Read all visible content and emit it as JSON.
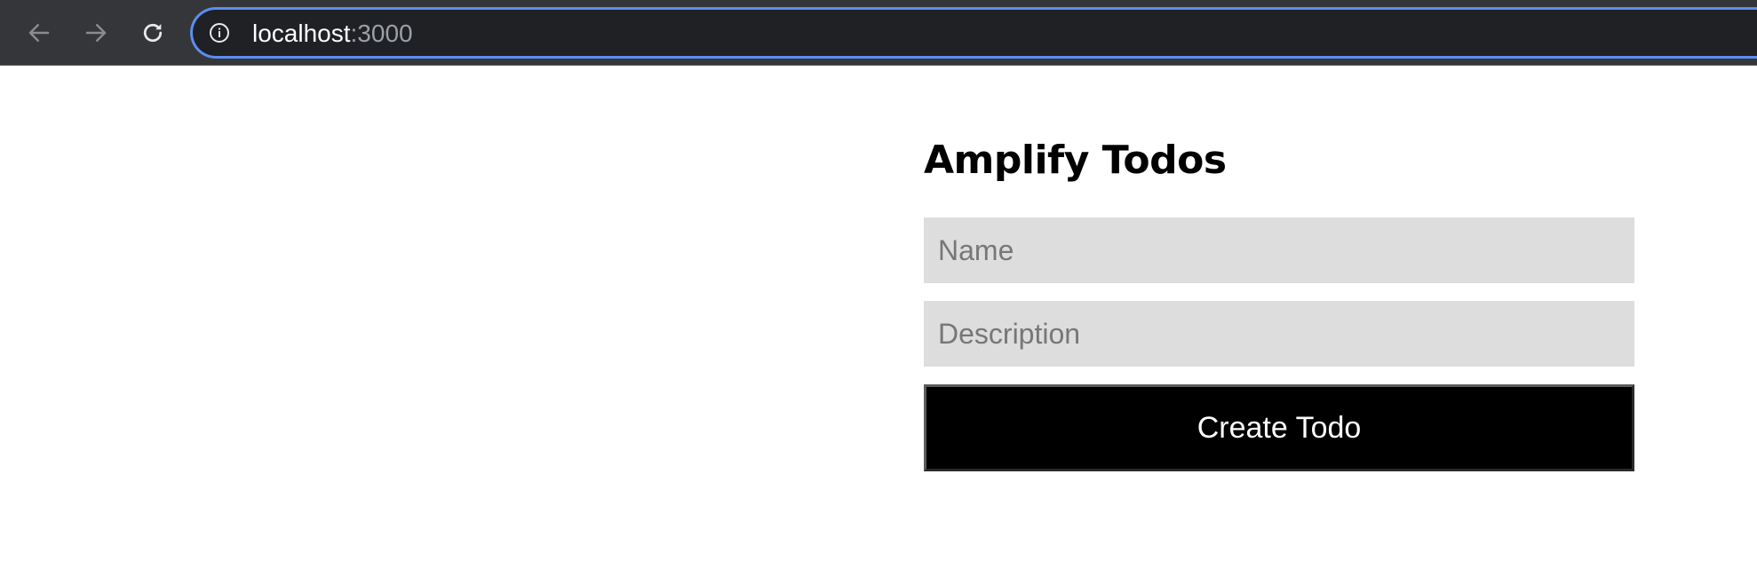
{
  "browser": {
    "url_host": "localhost",
    "url_port": ":3000",
    "icons": {
      "back": "arrow-left-icon",
      "forward": "arrow-right-icon",
      "reload": "reload-icon",
      "site_info": "info-icon"
    },
    "accent_color": "#5b8ef0"
  },
  "app": {
    "title": "Amplify Todos",
    "name_input": {
      "placeholder": "Name",
      "value": ""
    },
    "description_input": {
      "placeholder": "Description",
      "value": ""
    },
    "create_button_label": "Create Todo"
  }
}
